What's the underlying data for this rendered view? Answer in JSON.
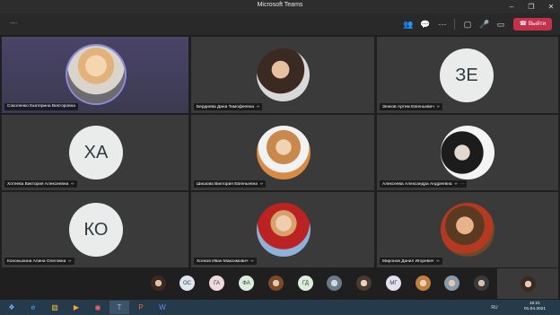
{
  "window": {
    "title": "Microsoft Teams"
  },
  "toolbar": {
    "leave_label": "Выйти",
    "leave_color": "#c4314b"
  },
  "participants": [
    {
      "name": "Соколенко Екатерина Викторовна",
      "avatar": "photo",
      "speaking": true
    },
    {
      "name": "Бердиева Дана Тимофеевна",
      "avatar": "photo"
    },
    {
      "name": "Зенков Артем Евгеньевич",
      "avatar": "initials",
      "initials": "ЗЕ",
      "avatar_color": "#d9ecee"
    },
    {
      "name": "Хотеева Виктория Алексеевна",
      "avatar": "initials",
      "initials": "ХА",
      "avatar_color": "#e4ebd9"
    },
    {
      "name": "Шишова Виктория Евгеньевна",
      "avatar": "photo"
    },
    {
      "name": "Алексеева Александра Андреевна",
      "avatar": "photo"
    },
    {
      "name": "Кононыхина Алина Олеговна",
      "avatar": "initials",
      "initials": "КО",
      "avatar_color": "#e6e6ef"
    },
    {
      "name": "Холков Иван Максимович",
      "avatar": "photo"
    },
    {
      "name": "Миронов Данил Игоревич",
      "avatar": "photo"
    }
  ],
  "strip": {
    "items": [
      {
        "type": "photo"
      },
      {
        "type": "initials",
        "initials": "ОС",
        "color": "#dfe6f0"
      },
      {
        "type": "initials",
        "initials": "ГА",
        "color": "#f1d8dc"
      },
      {
        "type": "initials",
        "initials": "ФА",
        "color": "#dbeedd"
      },
      {
        "type": "photo"
      },
      {
        "type": "initials",
        "initials": "ГД",
        "color": "#dbeedd"
      },
      {
        "type": "photo"
      },
      {
        "type": "photo"
      },
      {
        "type": "initials",
        "initials": "МГ",
        "color": "#e3e0f0"
      },
      {
        "type": "photo"
      },
      {
        "type": "photo"
      },
      {
        "type": "photo"
      }
    ]
  },
  "taskbar": {
    "lang": "RU",
    "time": "10:21",
    "date": "01.04.2021"
  }
}
